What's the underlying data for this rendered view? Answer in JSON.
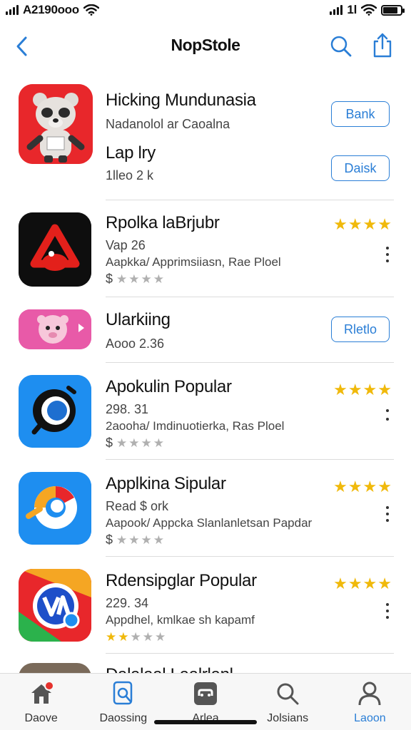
{
  "status_bar": {
    "carrier_time": "A2190ooo",
    "right_text": "1l",
    "battery_level": 0.85
  },
  "nav": {
    "title": "NopStole",
    "back_icon": "chevron-left-icon",
    "search_icon": "search-icon",
    "share_icon": "share-icon"
  },
  "apps": [
    {
      "name": "Hicking Mundunasia",
      "subtitle": "Nadanolol ar Caoalna",
      "button_label": "Bank"
    },
    {
      "name": "Lap lry",
      "subtitle": "1lleo 2 k",
      "button_label": "Daisk"
    },
    {
      "name": "Rpolka laBrjubr",
      "version": "Vap 26",
      "description": "Aapkka/ Apprimsiiasn, Rae Ploel",
      "price": "$",
      "rating_stars": 4,
      "price_gold_stars": 0,
      "price_gray_stars": 4
    },
    {
      "name": "Ularkiing",
      "subtitle": "Aooo 2.36",
      "button_label": "Rletlo"
    },
    {
      "name": "Apokulin Popular",
      "version": "298. 31",
      "description": "2aooha/ Imdinuotierka, Ras Ploel",
      "price": "$",
      "rating_stars": 4,
      "price_gold_stars": 0,
      "price_gray_stars": 4
    },
    {
      "name": "Applkina Sipular",
      "version": "Read $ ork",
      "description": "Aapook/ Appcka Slanlanletsan Papdar",
      "price": "$",
      "rating_stars": 4,
      "price_gold_stars": 0,
      "price_gray_stars": 4
    },
    {
      "name": "Rdensipglar Popular",
      "version": "229. 34",
      "description": "Appdhel, kmlkae sh kapamf",
      "price": "",
      "rating_stars": 4,
      "price_gold_stars": 2,
      "price_gray_stars": 3
    },
    {
      "name": "Dalalaal Laalrlanl"
    }
  ],
  "tabs": [
    {
      "label": "Daove",
      "icon": "home-icon",
      "badge": true
    },
    {
      "label": "Daossing",
      "icon": "search-document-icon"
    },
    {
      "label": "Arlea",
      "icon": "games-icon"
    },
    {
      "label": "Jolsians",
      "icon": "search-icon"
    },
    {
      "label": "Laoon",
      "icon": "profile-icon",
      "active": true
    }
  ],
  "colors": {
    "accent": "#2a7ed6",
    "star": "#f0b90b",
    "badge": "#e5322d"
  }
}
